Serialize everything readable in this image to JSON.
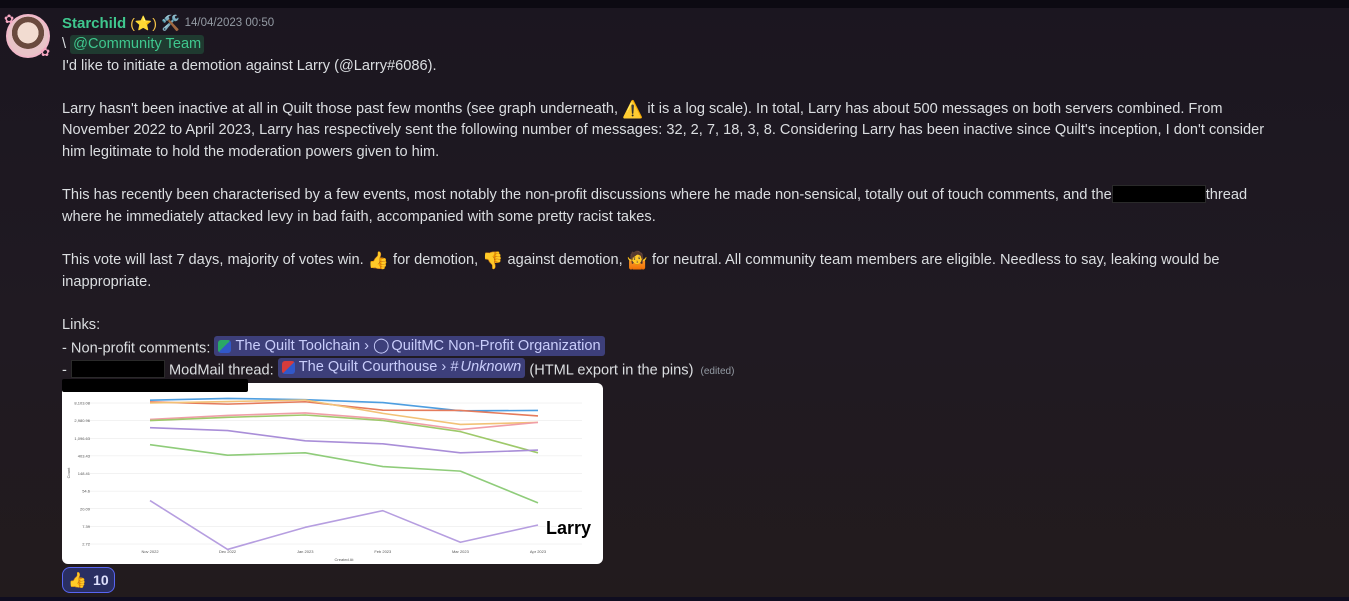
{
  "message": {
    "author": "Starchild",
    "badge": "(⭐)",
    "tools_icon": "🛠️",
    "timestamp": "14/04/2023 00:50",
    "reply_prefix": "\\",
    "mention": "@Community Team",
    "line1": "I'd like to initiate a demotion against Larry (@Larry#6086).",
    "p2_a": "Larry hasn't been inactive at all in Quilt those past few months (see graph underneath,",
    "p2_warn_icon": "⚠️",
    "p2_b": "it is a log scale). In total, Larry has about 500 messages on both servers combined. From",
    "p2_line2": "November 2022 to April 2023, Larry has respectively sent the following number of messages: 32, 2, 7, 18, 3, 8. Considering Larry has been inactive since Quilt's inception, I don't consider",
    "p2_line3": "him legitimate to hold the moderation powers given to him.",
    "p3_a": "This has recently been characterised by a few events, most notably the non-profit discussions where he made non-sensical, totally out of touch comments, and the",
    "p3_b": "thread",
    "p3_line2": "where he immediately attacked levy in bad faith, accompanied with some pretty racist takes.",
    "p4_a": "This vote will last 7 days, majority of votes win.",
    "p4_up": "👍",
    "p4_b": "for demotion,",
    "p4_down": "👎",
    "p4_c": "against demotion,",
    "p4_shrug": "🤷",
    "p4_d": "for neutral. All community team members are eligible. Needless to say, leaking would be",
    "p4_line2": "inappropriate.",
    "links_title": "Links:",
    "link1_prefix": "- Non-profit comments:",
    "link1_server": "The Quilt Toolchain",
    "link1_channel": "QuiltMC Non-Profit Organization",
    "link2_prefix": "-",
    "link2_mid": "ModMail thread:",
    "link2_server": "The Quilt Courthouse",
    "link2_channel": "Unknown",
    "link2_suffix": "(HTML export in the pins)",
    "edited": "(edited)"
  },
  "reaction": {
    "emoji": "👍",
    "count": "10"
  },
  "chart_data": {
    "type": "line",
    "title": "",
    "xlabel": "Created At",
    "ylabel": "Count",
    "scale": "log",
    "categories": [
      "Nov 2022",
      "Dec 2022",
      "Jan 2023",
      "Feb 2023",
      "Mar 2023",
      "Apr 2023"
    ],
    "y_ticks": [
      "2.72",
      "7.39",
      "20.09",
      "54.6",
      "148.41",
      "403.43",
      "1,096.63",
      "2,980.96",
      "8,103.08"
    ],
    "annotation": "Larry",
    "series": [
      {
        "color": "#4e9ee0",
        "values": [
          9500,
          10500,
          9800,
          8300,
          5200,
          5300
        ]
      },
      {
        "color": "#e57b5c",
        "values": [
          8600,
          7600,
          8700,
          5400,
          5300,
          3900
        ]
      },
      {
        "color": "#f2c277",
        "values": [
          8100,
          8800,
          9600,
          4500,
          2400,
          2700
        ]
      },
      {
        "color": "#f09ea8",
        "values": [
          3200,
          4000,
          4600,
          3300,
          1800,
          2700
        ]
      },
      {
        "color": "#9ec96a",
        "values": [
          3000,
          3600,
          4100,
          3000,
          1600,
          480
        ]
      },
      {
        "color": "#a98ed8",
        "values": [
          2000,
          1700,
          950,
          800,
          480,
          560
        ]
      },
      {
        "color": "#8fcc7a",
        "values": [
          760,
          420,
          480,
          220,
          170,
          28
        ]
      },
      {
        "color": "#b69ee0",
        "values": [
          32,
          2,
          7,
          18,
          3,
          8
        ]
      }
    ],
    "colors": {
      "background": "#ffffff",
      "grid": "#e6e6e6"
    }
  }
}
